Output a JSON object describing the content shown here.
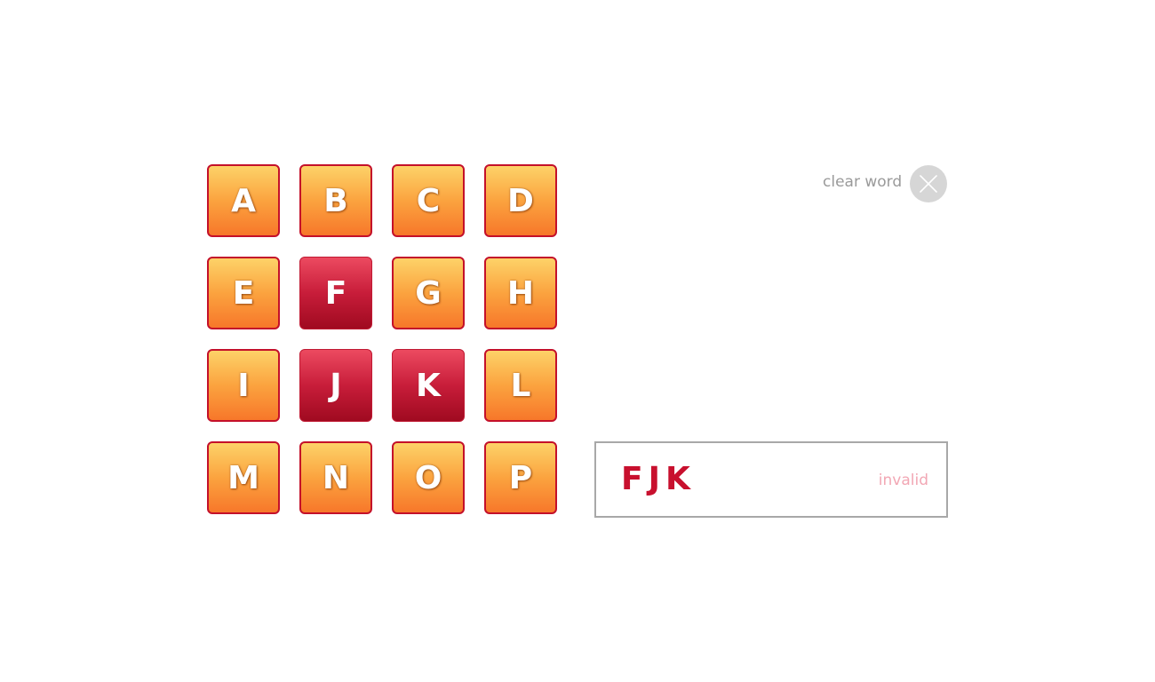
{
  "board": {
    "tiles": [
      {
        "letter": "A",
        "selected": false
      },
      {
        "letter": "B",
        "selected": false
      },
      {
        "letter": "C",
        "selected": false
      },
      {
        "letter": "D",
        "selected": false
      },
      {
        "letter": "E",
        "selected": false
      },
      {
        "letter": "F",
        "selected": true
      },
      {
        "letter": "G",
        "selected": false
      },
      {
        "letter": "H",
        "selected": false
      },
      {
        "letter": "I",
        "selected": false
      },
      {
        "letter": "J",
        "selected": true
      },
      {
        "letter": "K",
        "selected": true
      },
      {
        "letter": "L",
        "selected": false
      },
      {
        "letter": "M",
        "selected": false
      },
      {
        "letter": "N",
        "selected": false
      },
      {
        "letter": "O",
        "selected": false
      },
      {
        "letter": "P",
        "selected": false
      }
    ]
  },
  "controls": {
    "clear_label": "clear word",
    "clear_icon": "close-icon"
  },
  "word": {
    "current": "FJK",
    "status": "invalid"
  },
  "colors": {
    "tile_top": "#fdd268",
    "tile_bottom": "#f7772a",
    "selected_top": "#ec4a60",
    "selected_bottom": "#a00a20",
    "tile_border": "#c4102a",
    "word_text": "#c8102e",
    "status_text": "#f2a7b4",
    "clear_text": "#9a9a9a",
    "clear_circle": "#d6d6d6"
  }
}
